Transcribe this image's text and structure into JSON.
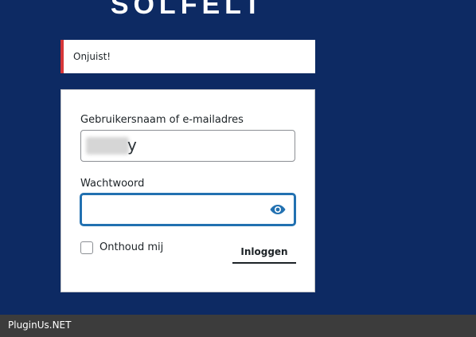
{
  "brand": {
    "text": "SOLFELT"
  },
  "notice": {
    "text": "Onjuist!",
    "accent_color": "#d63638"
  },
  "login_form": {
    "username_label": "Gebruikersnaam of e-mailadres",
    "username_value_visible": "y",
    "password_label": "Wachtwoord",
    "password_value": "",
    "show_password_icon": "eye-icon",
    "remember_label": "Onthoud mij",
    "remember_checked": false,
    "submit_label": "Inloggen"
  },
  "footer": {
    "text": "PluginUs.NET"
  },
  "colors": {
    "background": "#0d2a63",
    "focus": "#2271b1",
    "card": "#ffffff"
  }
}
